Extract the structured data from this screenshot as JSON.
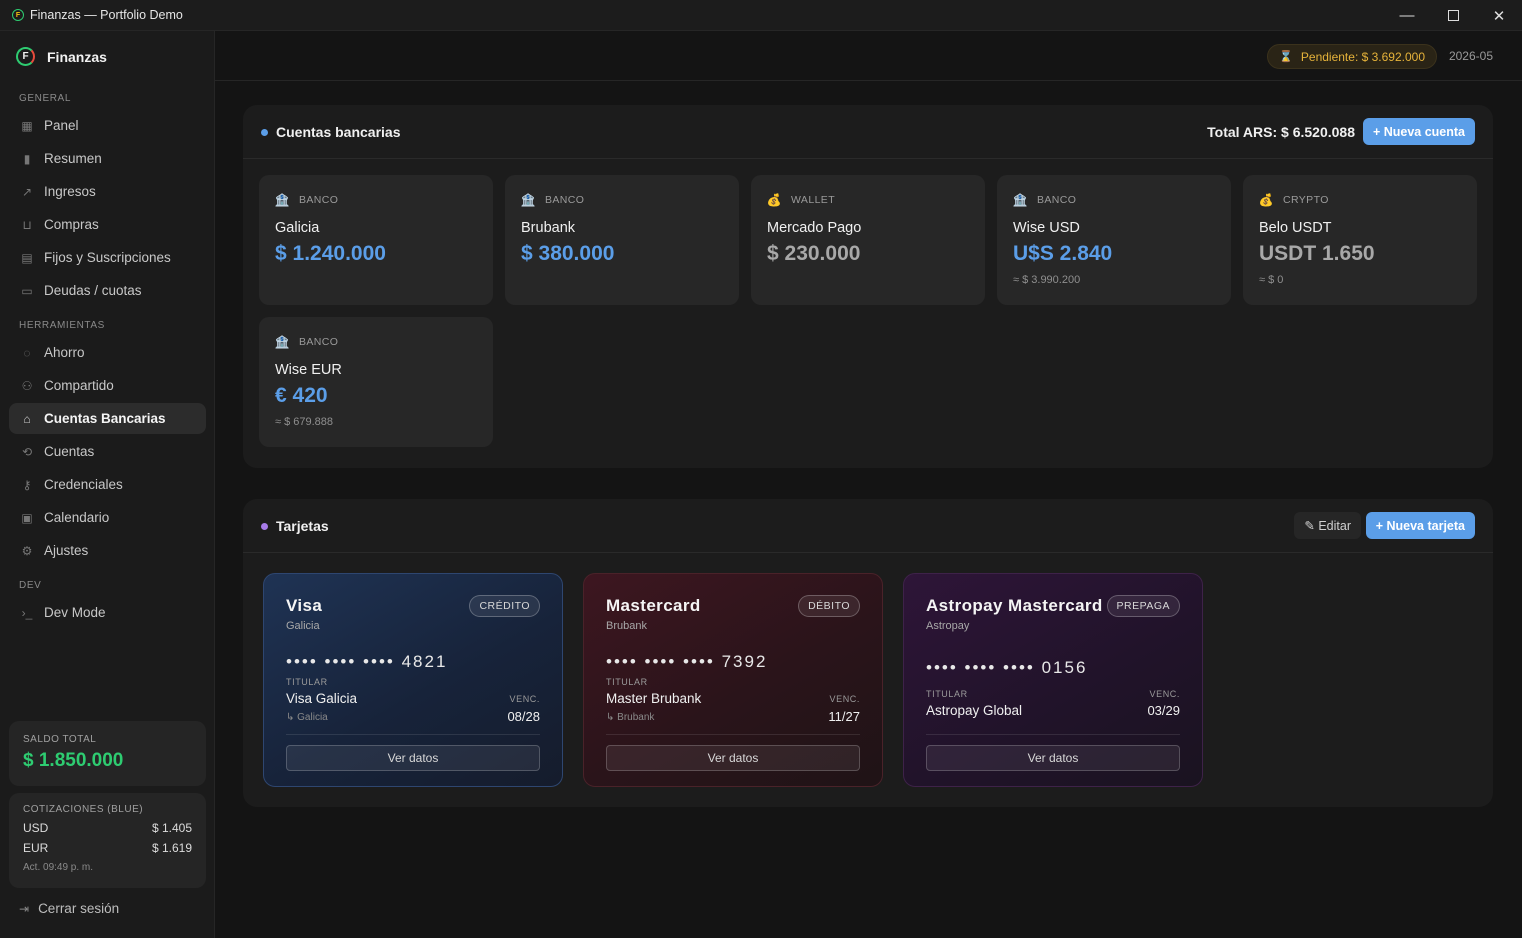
{
  "window": {
    "title": "Finanzas — Portfolio Demo"
  },
  "brand": {
    "name": "Finanzas",
    "logo_letter": "F"
  },
  "sidebar": {
    "sections": [
      {
        "label": "GENERAL"
      },
      {
        "label": "HERRAMIENTAS"
      },
      {
        "label": "DEV"
      }
    ],
    "items": [
      {
        "label": "Panel",
        "icon": "grid-icon"
      },
      {
        "label": "Resumen",
        "icon": "bar-chart-icon"
      },
      {
        "label": "Ingresos",
        "icon": "trend-up-icon"
      },
      {
        "label": "Compras",
        "icon": "cart-icon"
      },
      {
        "label": "Fijos y Suscripciones",
        "icon": "receipt-icon"
      },
      {
        "label": "Deudas / cuotas",
        "icon": "credit-card-icon"
      },
      {
        "label": "Ahorro",
        "icon": "piggy-bank-icon"
      },
      {
        "label": "Compartido",
        "icon": "users-icon"
      },
      {
        "label": "Cuentas Bancarias",
        "icon": "bank-icon",
        "active": true
      },
      {
        "label": "Cuentas",
        "icon": "repeat-icon"
      },
      {
        "label": "Credenciales",
        "icon": "key-icon"
      },
      {
        "label": "Calendario",
        "icon": "calendar-icon"
      },
      {
        "label": "Ajustes",
        "icon": "gear-icon"
      },
      {
        "label": "Dev Mode",
        "icon": "terminal-icon"
      }
    ],
    "saldo": {
      "label": "SALDO TOTAL",
      "value": "$ 1.850.000"
    },
    "cotizaciones": {
      "label": "COTIZACIONES (BLUE)",
      "rows": [
        {
          "currency": "USD",
          "value": "$ 1.405"
        },
        {
          "currency": "EUR",
          "value": "$ 1.619"
        }
      ],
      "updated": "Act. 09:49 p. m."
    },
    "logout_label": "Cerrar sesión"
  },
  "topbar": {
    "pending": "Pendiente: $ 3.692.000",
    "period": "2026-05"
  },
  "cuentas": {
    "title": "Cuentas bancarias",
    "total": "Total ARS: $ 6.520.088",
    "new_button": "+ Nueva cuenta",
    "items": [
      {
        "type": "BANCO",
        "name": "Galicia",
        "balance": "$ 1.240.000",
        "conversion": "",
        "color": "#5b9ee8"
      },
      {
        "type": "BANCO",
        "name": "Brubank",
        "balance": "$ 380.000",
        "conversion": "",
        "color": "#5b9ee8"
      },
      {
        "type": "WALLET",
        "name": "Mercado Pago",
        "balance": "$ 230.000",
        "conversion": "",
        "color": "#a8a8a8"
      },
      {
        "type": "BANCO",
        "name": "Wise USD",
        "balance": "U$S 2.840",
        "conversion": "≈ $ 3.990.200",
        "color": "#5b9ee8"
      },
      {
        "type": "CRYPTO",
        "name": "Belo USDT",
        "balance": "USDT 1.650",
        "conversion": "≈ $ 0",
        "color": "#a8a8a8"
      },
      {
        "type": "BANCO",
        "name": "Wise EUR",
        "balance": "€ 420",
        "conversion": "≈ $ 679.888",
        "color": "#5b9ee8"
      }
    ]
  },
  "tarjetas": {
    "title": "Tarjetas",
    "edit_button": "✎ Editar",
    "new_button": "+ Nueva tarjeta",
    "titular_label": "TITULAR",
    "venc_label": "VENC.",
    "view_button": "Ver datos",
    "items": [
      {
        "name": "Visa",
        "bank": "Galicia",
        "badge": "CRÉDITO",
        "number": "•••• •••• •••• 4821",
        "holder": "Visa Galicia",
        "linked": "↳ Galicia",
        "expiry": "08/28"
      },
      {
        "name": "Mastercard",
        "bank": "Brubank",
        "badge": "DÉBITO",
        "number": "•••• •••• •••• 7392",
        "holder": "Master Brubank",
        "linked": "↳ Brubank",
        "expiry": "11/27"
      },
      {
        "name": "Astropay Mastercard",
        "bank": "Astropay",
        "badge": "PREPAGA",
        "number": "•••• •••• •••• 0156",
        "holder": "Astropay Global",
        "linked": "",
        "expiry": "03/29"
      }
    ]
  }
}
